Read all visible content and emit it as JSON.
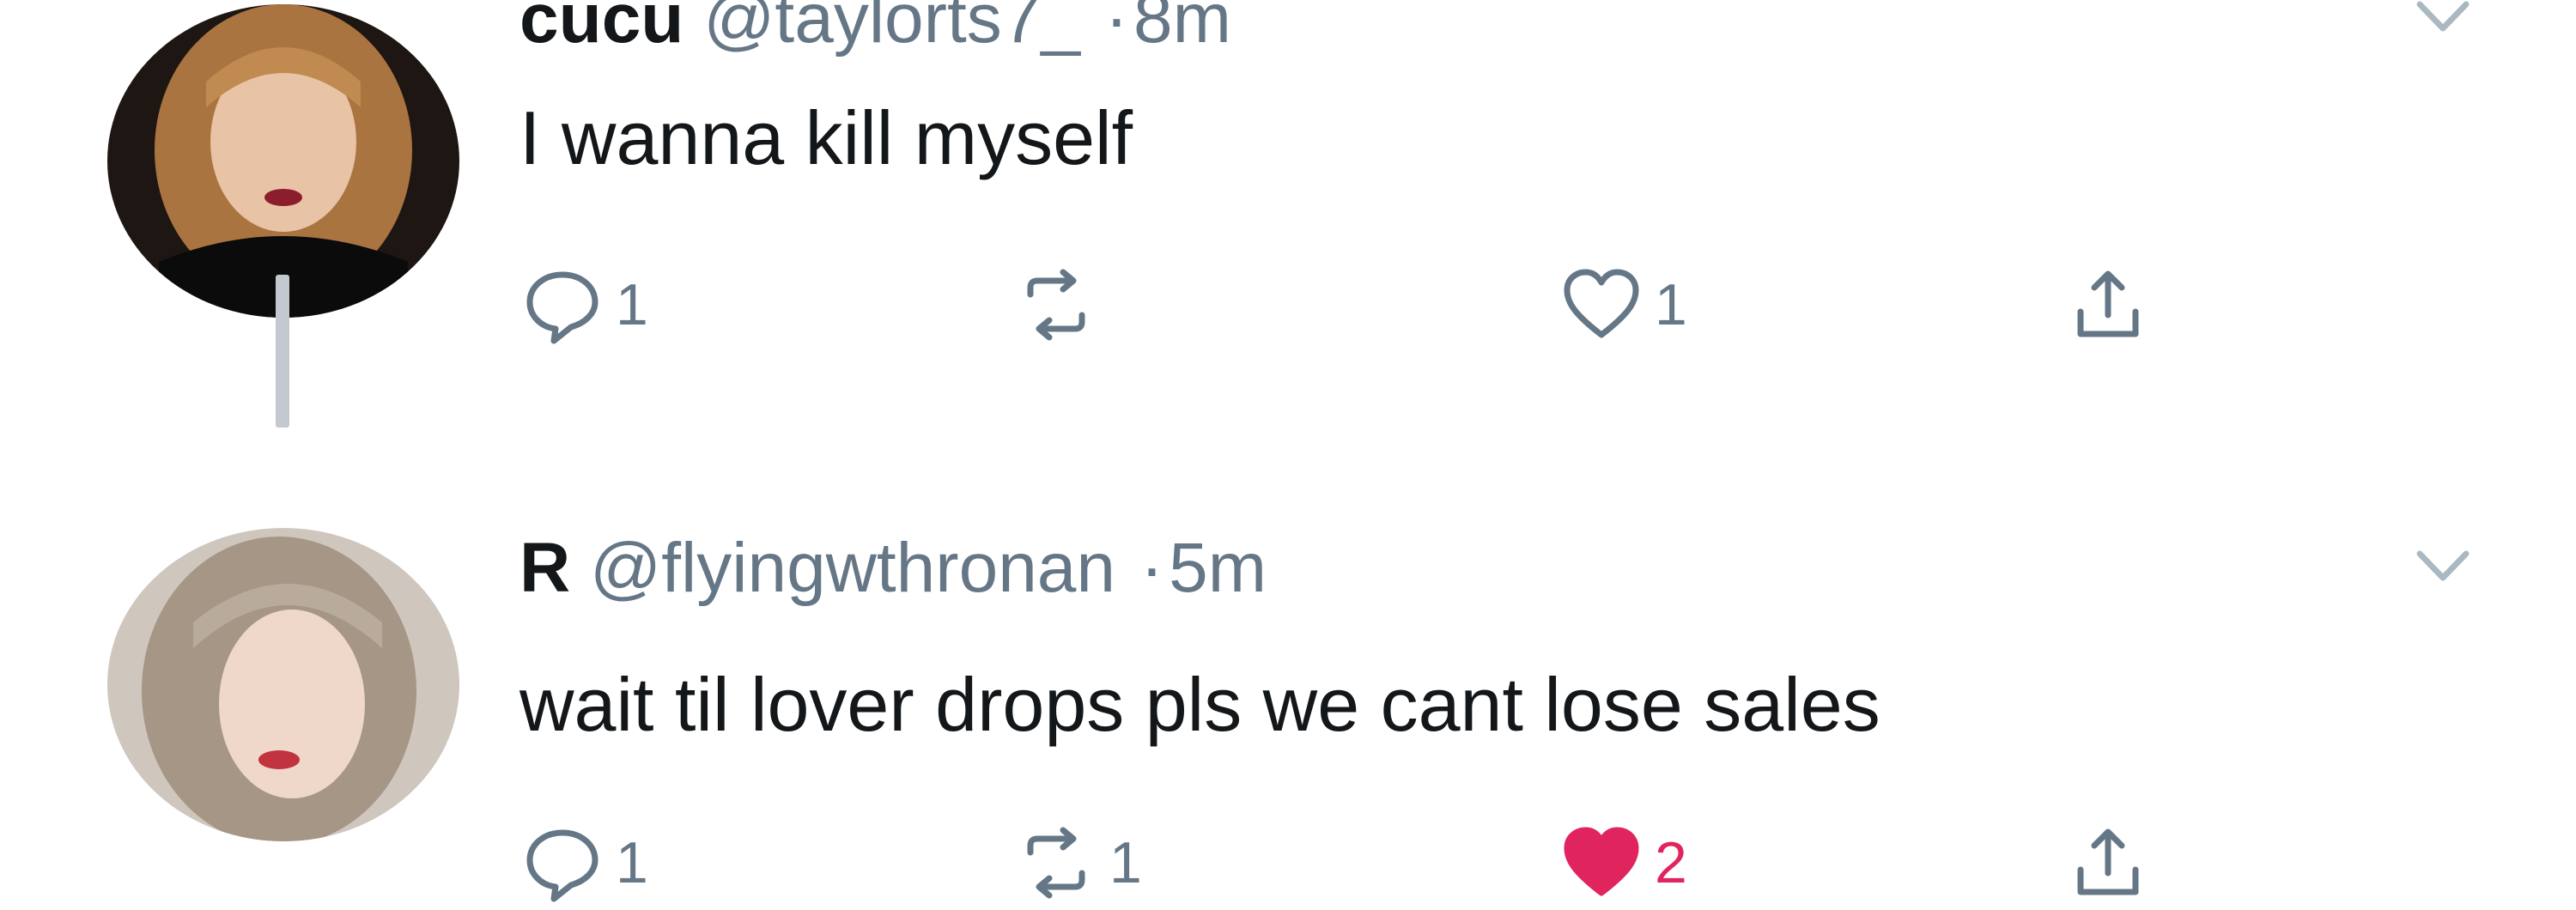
{
  "tweets": [
    {
      "display_name": "cucu",
      "handle": "@taylorts7_",
      "separator": "·",
      "time": "8m",
      "text": "I wanna kill myself",
      "reply_count": "1",
      "retweet_count": "",
      "like_count": "1",
      "liked": false
    },
    {
      "display_name": "R",
      "handle": "@flyingwthronan",
      "separator": "·",
      "time": "5m",
      "text": "wait til lover drops pls we cant lose sales",
      "reply_count": "1",
      "retweet_count": "1",
      "like_count": "2",
      "liked": true
    }
  ],
  "icons": {
    "reply": "reply-icon",
    "retweet": "retweet-icon",
    "like": "heart-icon",
    "share": "share-icon",
    "caret": "chevron-down-icon"
  },
  "colors": {
    "text": "#14171a",
    "muted": "#657786",
    "like": "#e0245e",
    "thread_line": "#c4c9cf"
  }
}
